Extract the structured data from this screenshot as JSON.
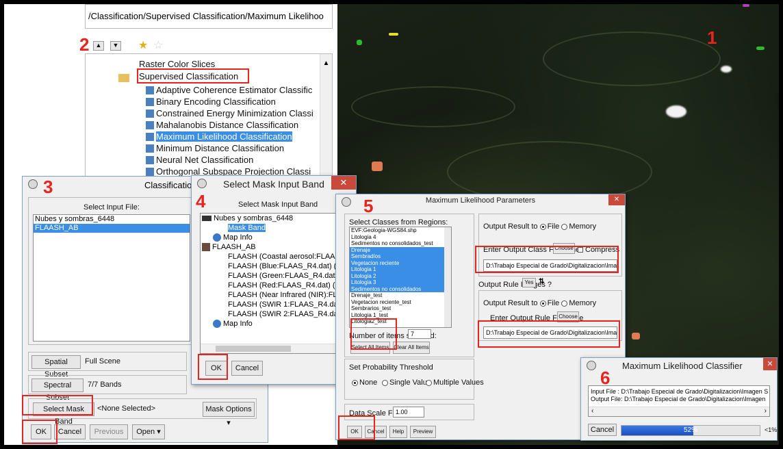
{
  "step_numbers": {
    "n1": "1",
    "n2": "2",
    "n3": "3",
    "n4": "4",
    "n5": "5",
    "n6": "6"
  },
  "toolbox": {
    "path": "/Classification/Supervised Classification/Maximum Likelihoo",
    "items": [
      {
        "label": "Raster Color Slices"
      },
      {
        "label": "Supervised Classification"
      },
      {
        "label": "Adaptive Coherence Estimator Classific"
      },
      {
        "label": "Binary Encoding Classification"
      },
      {
        "label": "Constrained Energy Minimization Classi"
      },
      {
        "label": "Mahalanobis Distance Classification"
      },
      {
        "label": "Maximum Likelihood Classification"
      },
      {
        "label": "Minimum Distance Classification"
      },
      {
        "label": "Neural Net Classification"
      },
      {
        "label": "Orthogonal Subspace Projection Classi"
      }
    ]
  },
  "input_dialog": {
    "title": "Classificatio",
    "select_input_label": "Select Input File:",
    "files": [
      "Nubes y sombras_6448",
      "FLAASH_AB"
    ],
    "spatial_subset_btn": "Spatial Subset",
    "spatial_subset_val": "Full Scene",
    "spectral_subset_btn": "Spectral Subset",
    "spectral_subset_val": "7/7 Bands",
    "select_mask_btn": "Select Mask Band",
    "mask_val": "<None Selected>",
    "mask_options_btn": "Mask Options ▾",
    "ok": "OK",
    "cancel": "Cancel",
    "previous": "Previous",
    "open": "Open ▾"
  },
  "mask_dialog": {
    "title": "Select Mask Input Band",
    "header": "Select Mask Input Band",
    "tree": [
      "Nubes y sombras_6448",
      "Mask Band",
      "Map Info",
      "FLAASH_AB",
      "FLAASH (Coastal aerosol:FLAAS",
      "FLAASH (Blue:FLAAS_R4.dat) (",
      "FLAASH (Green:FLAAS_R4.dat)",
      "FLAASH (Red:FLAAS_R4.dat) (0",
      "FLAASH (Near Infrared (NIR):FL",
      "FLAASH (SWIR 1:FLAAS_R4.da",
      "FLAASH (SWIR 2:FLAAS_R4.da",
      "Map Info"
    ],
    "ok": "OK",
    "cancel": "Cancel"
  },
  "params_dialog": {
    "title": "Maximum Likelihood Parameters",
    "select_classes_label": "Select Classes from Regions:",
    "classes": [
      {
        "label": "EVF:Geologia-WGS84.shp",
        "selected": false
      },
      {
        "label": "Litologia 4",
        "selected": false
      },
      {
        "label": "Sedimentos no consolidados_test",
        "selected": false
      },
      {
        "label": "Drenaje",
        "selected": true
      },
      {
        "label": "Sembradíos",
        "selected": true
      },
      {
        "label": "Vegetacion reciente",
        "selected": true
      },
      {
        "label": "Litologia 1",
        "selected": true
      },
      {
        "label": "Litologia 2",
        "selected": true
      },
      {
        "label": "Litologia 3",
        "selected": true
      },
      {
        "label": "Sedimentos no consolidados",
        "selected": true
      },
      {
        "label": "Drenaje_test",
        "selected": false
      },
      {
        "label": "Vegetacion reciente_test",
        "selected": false
      },
      {
        "label": "Sembrarios_test",
        "selected": false
      },
      {
        "label": "Litologia 1_test",
        "selected": false
      },
      {
        "label": "Litologia2_test",
        "selected": false
      }
    ],
    "num_selected_label": "Number of items selected:",
    "num_selected": "7",
    "select_all": "Select All Items",
    "clear_all": "Clear All Items",
    "prob_label": "Set Probability Threshold",
    "prob_none": "None",
    "prob_single": "Single Value",
    "prob_multiple": "Multiple Values",
    "scale_label": "Data Scale Factor",
    "scale_value": "1.00",
    "output_result_label": "Output Result to",
    "file": "File",
    "memory": "Memory",
    "out_class_label": "Enter Output Class Filename",
    "choose": "Choose",
    "compress": "Compress",
    "out_class_path": "D:\\Trabajo Especial de Grado\\Digitalizacion\\Imagen Sat",
    "rule_images_label": "Output Rule Images ?",
    "yes": "Yes",
    "out_rule_label": "Enter Output Rule Filename",
    "out_rule_path": "D:\\Trabajo Especial de Grado\\Digitalizacion\\Imager",
    "ok": "OK",
    "cancel": "Cancel",
    "help": "Help",
    "preview": "Preview"
  },
  "classifier_dialog": {
    "title": "Maximum Likelihood Classifier",
    "input_file": "Input File : D:\\Trabajo Especial de Grado\\Digitalizacion\\Imagen S",
    "output_file": "Output File: D:\\Trabajo Especial de Grado\\Digitalizacion\\Imagen",
    "cancel": "Cancel",
    "progress_label": "52%",
    "progress": 0.52,
    "right_label": "<1%"
  }
}
